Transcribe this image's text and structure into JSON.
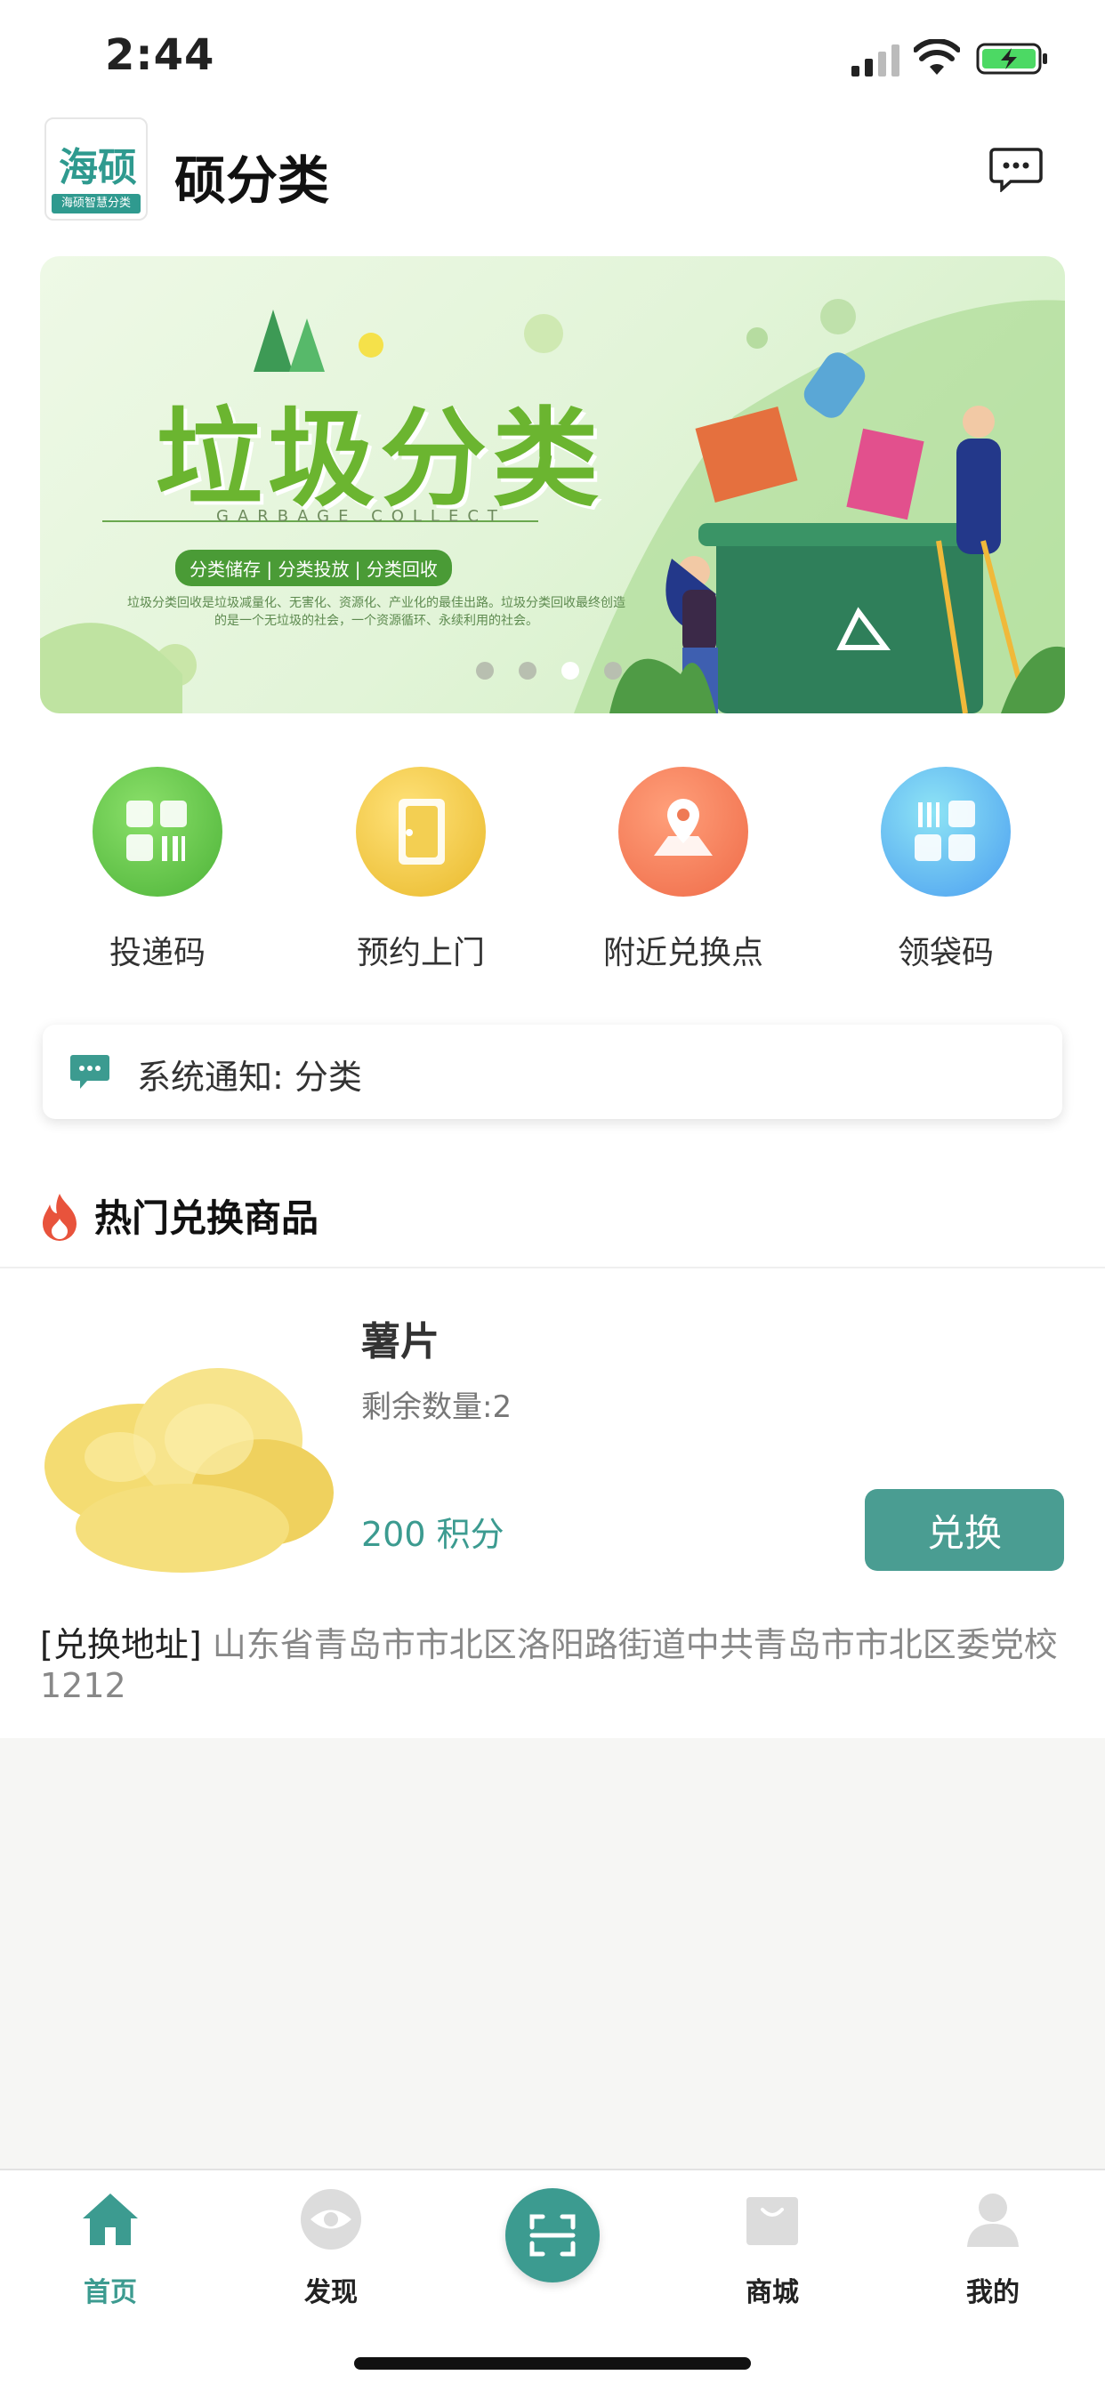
{
  "status": {
    "time": "2:44"
  },
  "header": {
    "title": "硕分类",
    "logo_text": "海硕",
    "logo_sub": "海硕智慧分类"
  },
  "banner": {
    "title": "垃圾分类",
    "subtitle": "GARBAGE COLLECT",
    "pill": "分类储存 | 分类投放 | 分类回收",
    "desc": "垃圾分类回收是垃圾减量化、无害化、资源化、产业化的最佳出路。垃圾分类回收最终创造的是一个无垃圾的社会，一个资源循环、永续利用的社会。",
    "active_dot": 2
  },
  "quick_actions": [
    {
      "label": "投递码",
      "icon": "grid-code-icon",
      "color": "#5cc04a"
    },
    {
      "label": "预约上门",
      "icon": "door-icon",
      "color": "#f2c536"
    },
    {
      "label": "附近兑换点",
      "icon": "location-pin-icon",
      "color": "#f27a55"
    },
    {
      "label": "领袋码",
      "icon": "bag-code-icon",
      "color": "#5aa9f2"
    }
  ],
  "notice": {
    "text": "系统通知: 分类"
  },
  "section": {
    "title": "热门兑换商品"
  },
  "product": {
    "name": "薯片",
    "stock": "剩余数量:2",
    "points": "200 积分",
    "button": "兑换",
    "address_label": "[兑换地址]",
    "address": "山东省青岛市市北区洛阳路街道中共青岛市市北区委党校 1212"
  },
  "tabbar": [
    {
      "label": "首页",
      "icon": "home-icon",
      "active": true
    },
    {
      "label": "发现",
      "icon": "eye-icon",
      "active": false
    },
    {
      "label": "",
      "icon": "scan-icon",
      "active": false
    },
    {
      "label": "商城",
      "icon": "shopping-bag-icon",
      "active": false
    },
    {
      "label": "我的",
      "icon": "user-icon",
      "active": false
    }
  ],
  "colors": {
    "accent": "#3c9b90",
    "button": "#4a9d92"
  }
}
